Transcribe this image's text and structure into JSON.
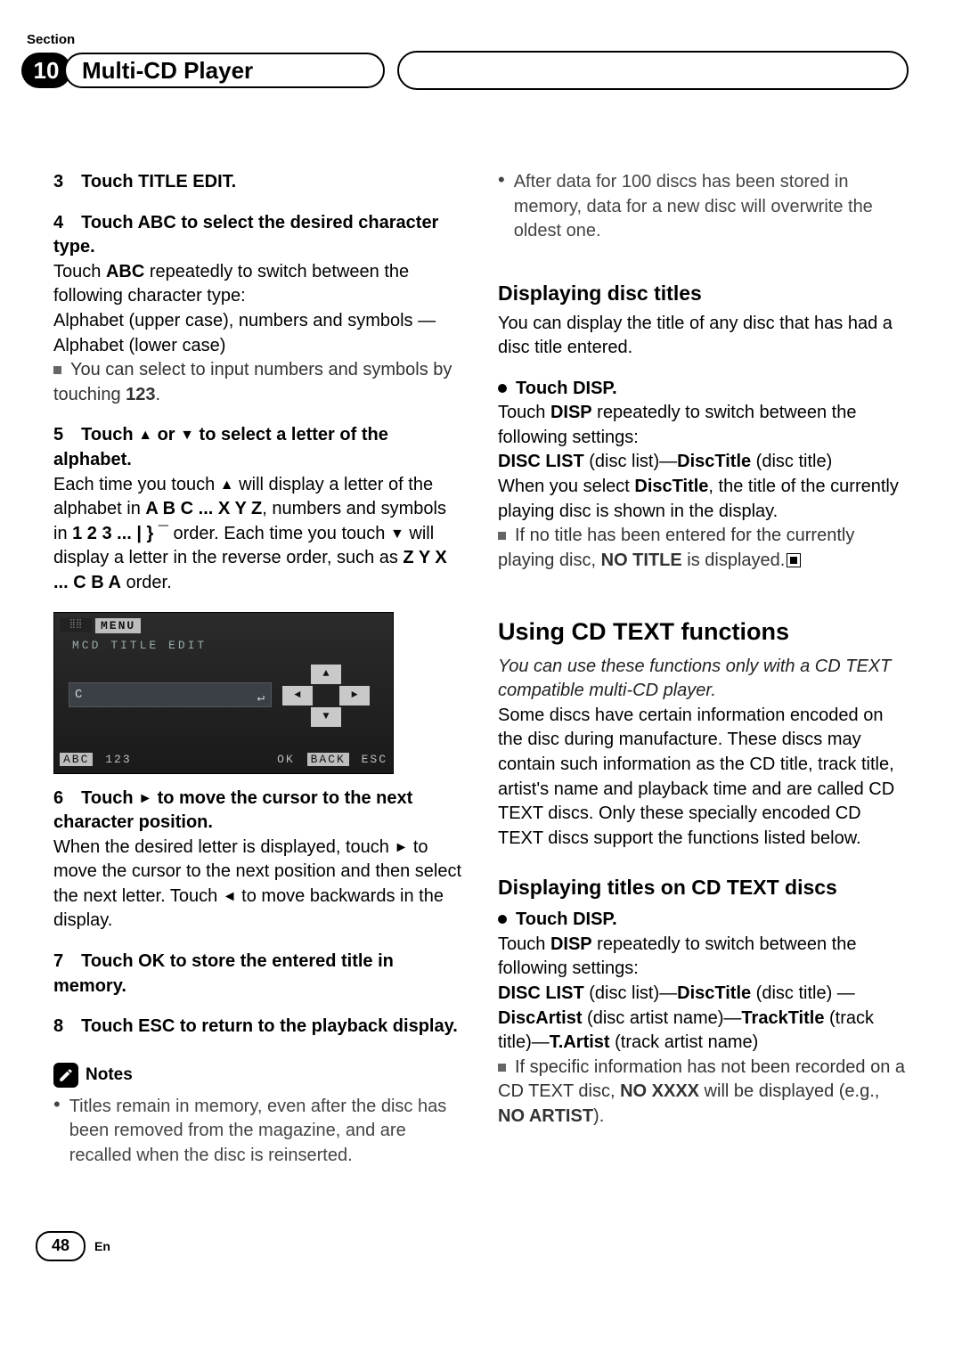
{
  "section_label": "Section",
  "section_number": "10",
  "section_title": "Multi-CD Player",
  "left": {
    "step3": "3 Touch TITLE EDIT.",
    "step4_head": "4 Touch ABC to select the desired character type.",
    "step4_b1a": "Touch ",
    "step4_b1b": "ABC",
    "step4_b1c": " repeatedly to switch between the following character type:",
    "step4_b2": "Alphabet (upper case), numbers and symbols —Alphabet (lower case)",
    "step4_note_a": "You can select to input numbers and symbols by touching ",
    "step4_note_b": "123",
    "step4_note_c": ".",
    "step5_head_a": "5 Touch ",
    "step5_head_b": " or ",
    "step5_head_c": " to select a letter of the alphabet.",
    "step5_b1a": "Each time you touch ",
    "step5_b1b": " will display a letter of the alphabet in ",
    "step5_b1c": "A B C ... X Y Z",
    "step5_b1d": ", numbers and symbols in ",
    "step5_b1e": "1 2 3 ... | } ¯",
    "step5_b1f": " order. Each time you touch ",
    "step5_b1g": " will display a letter in the reverse order, such as ",
    "step5_b1h": "Z Y X ... C B A",
    "step5_b1i": " order.",
    "screenshot": {
      "menu": "MENU",
      "sub": "MCD  TITLE  EDIT",
      "input": "C",
      "bottom_abc": "ABC",
      "bottom_123": "123",
      "bottom_ok": "OK",
      "bottom_back": "BACK",
      "bottom_esc": "ESC"
    },
    "step6_head_a": "6 Touch ",
    "step6_head_b": " to move the cursor to the next character position.",
    "step6_b1a": "When the desired letter is displayed, touch ",
    "step6_b1b": " to move the cursor to the next position and then select the next letter. Touch ",
    "step6_b1c": " to move backwards in the display.",
    "step7": "7 Touch OK to store the entered title in memory.",
    "step8": "8 Touch ESC to return to the playback display.",
    "notes_label": "Notes",
    "note1": "Titles remain in memory, even after the disc has been removed from the magazine, and are recalled when the disc is reinserted."
  },
  "right": {
    "note2": "After data for 100 discs has been stored in memory, data for a new disc will overwrite the oldest one.",
    "h3_disp_titles": "Displaying disc titles",
    "disp_titles_body": "You can display the title of any disc that has had a disc title entered.",
    "touch_disp": "Touch DISP.",
    "disp_body_a": "Touch ",
    "disp_body_b": "DISP",
    "disp_body_c": " repeatedly to switch between the following settings:",
    "disclist": "DISC LIST",
    "disclist_p": " (disc list)—",
    "disctitle": "DiscTitle",
    "disctitle_p": " (disc title)",
    "disp_body2a": "When you select ",
    "disp_body2b": "DiscTitle",
    "disp_body2c": ", the title of the currently playing disc is shown in the display.",
    "disp_note_a": "If no title has been entered for the currently playing disc, ",
    "disp_note_b": "NO TITLE",
    "disp_note_c": " is displayed.",
    "h2_cdtext": "Using CD TEXT functions",
    "cdtext_italic": "You can use these functions only with a CD TEXT compatible multi-CD player.",
    "cdtext_body": "Some discs have certain information encoded on the disc during manufacture. These discs may contain such information as the CD title, track title, artist's name and playback time and are called CD TEXT discs. Only these specially encoded CD TEXT discs support the functions listed below.",
    "h3_cdtext_titles": "Displaying titles on CD TEXT discs",
    "touch_disp2": "Touch DISP.",
    "ct_body_a": "Touch ",
    "ct_body_b": "DISP",
    "ct_body_c": " repeatedly to switch between the following settings:",
    "ct_line1a": "DISC LIST",
    "ct_line1b": " (disc list)—",
    "ct_line1c": "DiscTitle",
    "ct_line1d": " (disc title) —",
    "ct_line1e": "DiscArtist",
    "ct_line1f": " (disc artist name)—",
    "ct_line1g": "TrackTitle",
    "ct_line1h": " (track title)—",
    "ct_line1i": "T.Artist",
    "ct_line1j": " (track artist name)",
    "ct_note_a": "If specific information has not been recorded on a CD TEXT disc, ",
    "ct_note_b": "NO XXXX",
    "ct_note_c": " will be displayed (e.g., ",
    "ct_note_d": "NO ARTIST",
    "ct_note_e": ")."
  },
  "footer": {
    "page": "48",
    "lang": "En"
  }
}
